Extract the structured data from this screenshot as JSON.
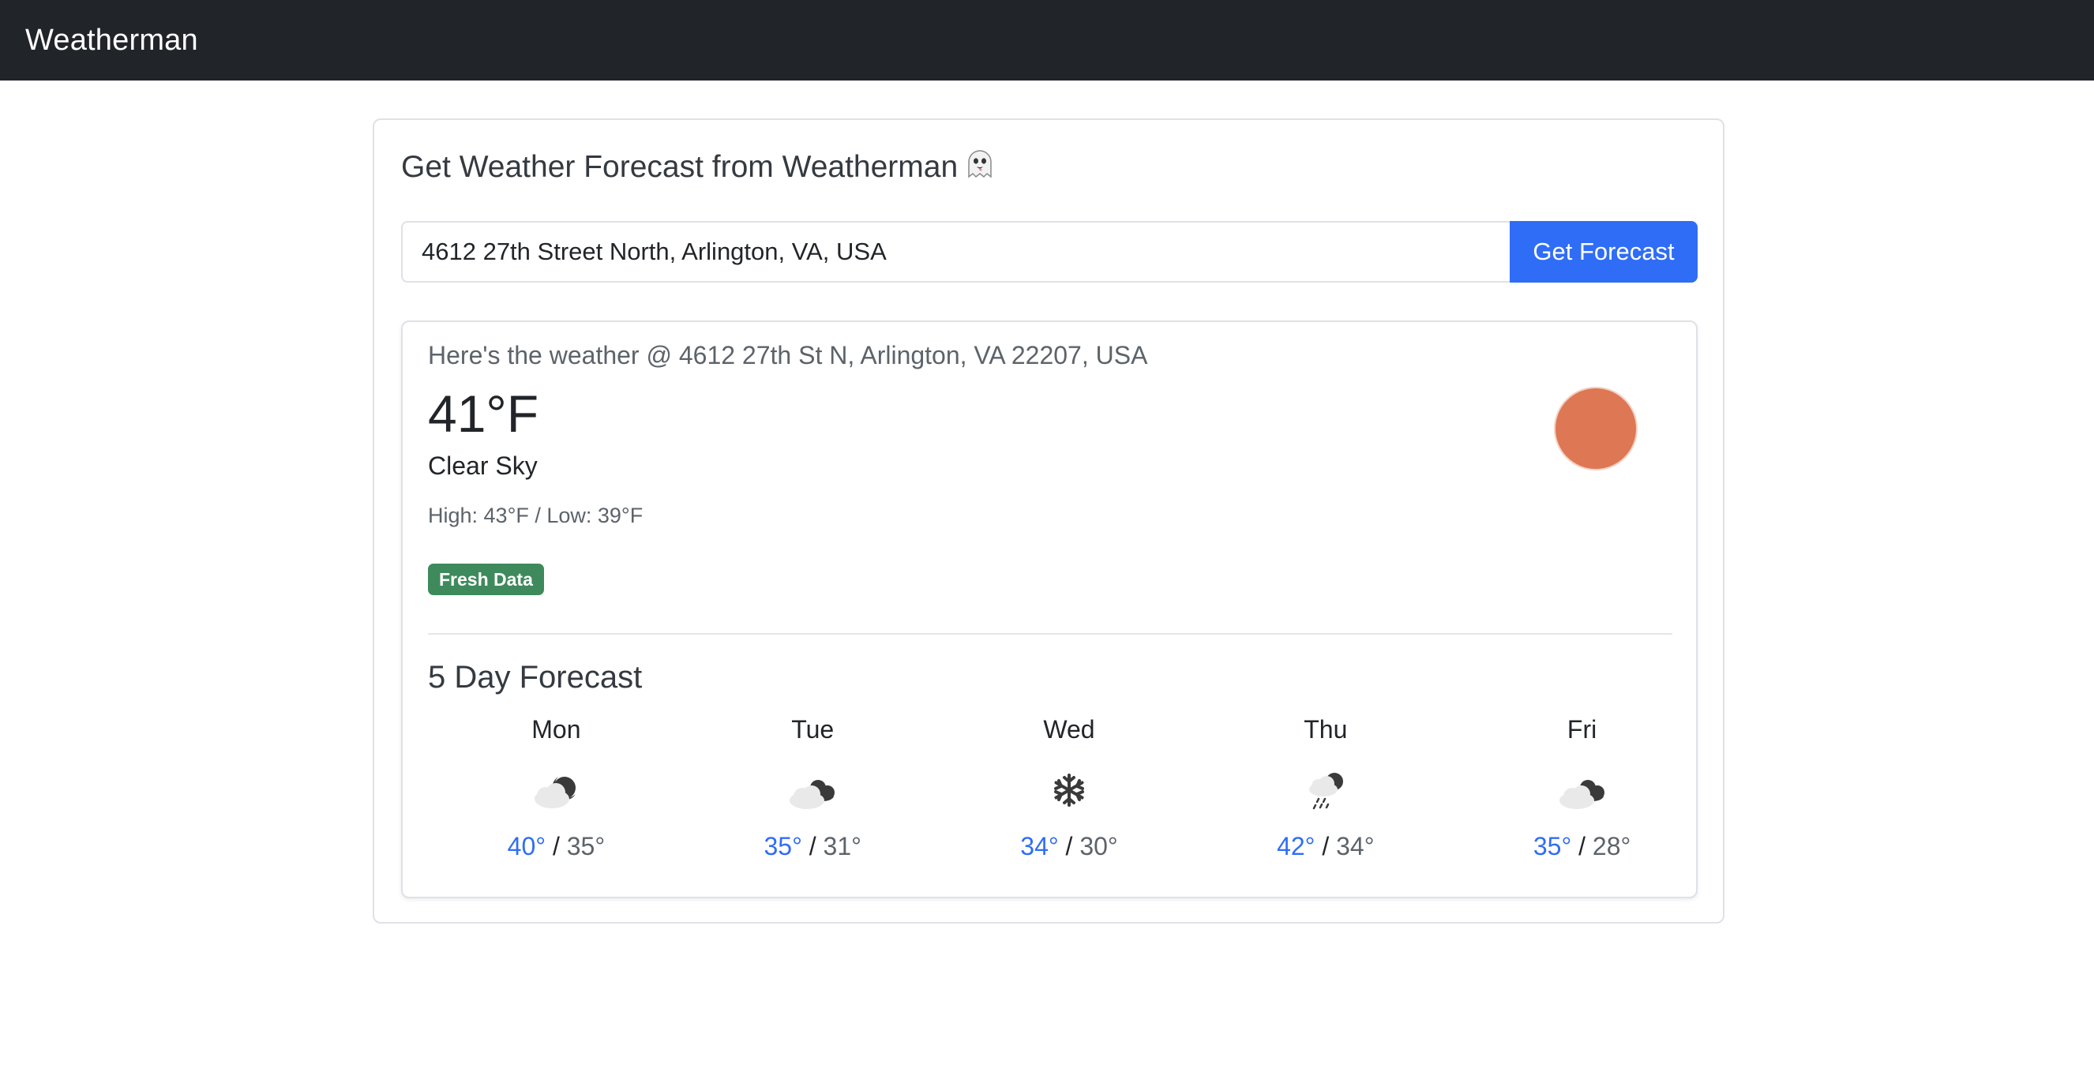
{
  "navbar": {
    "brand": "Weatherman"
  },
  "header": {
    "title": "Get Weather Forecast from Weatherman"
  },
  "search": {
    "value": "4612 27th Street North, Arlington, VA, USA",
    "button_label": "Get Forecast"
  },
  "current": {
    "location_text": "Here's the weather @ 4612 27th St N, Arlington, VA 22207, USA",
    "temperature": "41°F",
    "condition": "Clear Sky",
    "high_low": "High: 43°F / Low: 39°F",
    "badge": "Fresh Data",
    "icon": "sun-icon",
    "icon_color": "#de7753"
  },
  "forecast": {
    "title": "5 Day Forecast",
    "separator": "/",
    "days": [
      {
        "day": "Mon",
        "icon": "partly-cloudy-night-icon",
        "high": "40°",
        "low": "35°"
      },
      {
        "day": "Tue",
        "icon": "cloudy-icon",
        "high": "35°",
        "low": "31°"
      },
      {
        "day": "Wed",
        "icon": "snowflake-icon",
        "high": "34°",
        "low": "30°"
      },
      {
        "day": "Thu",
        "icon": "sleet-icon",
        "high": "42°",
        "low": "34°"
      },
      {
        "day": "Fri",
        "icon": "cloudy-icon",
        "high": "35°",
        "low": "28°"
      }
    ]
  },
  "colors": {
    "navbar": "#212529",
    "primary": "#2f6df6",
    "badge": "#3e8a5c",
    "high_temp": "#2f6df6"
  }
}
